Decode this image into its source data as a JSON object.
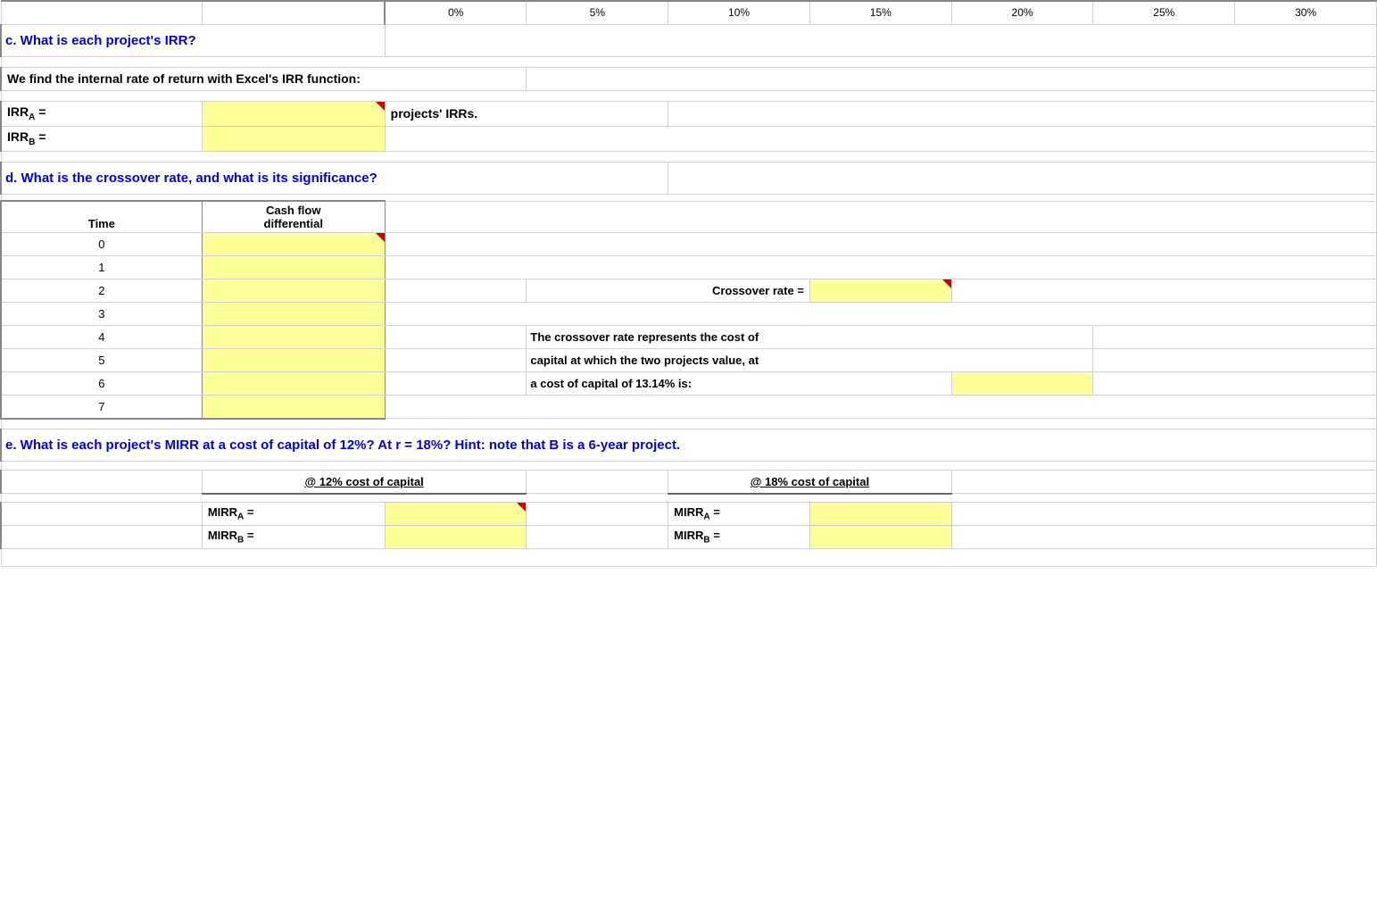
{
  "header": {
    "pct_labels": [
      "0%",
      "5%",
      "10%",
      "15%",
      "20%",
      "25%",
      "30%"
    ]
  },
  "section_c": {
    "title": "c.   What is each project's IRR?",
    "description": "We find the internal rate of return with Excel's  IRR function:",
    "irr_a_label": "IRR",
    "irr_a_sub": "A",
    "irr_a_equals": " =",
    "irr_b_label": "IRR",
    "irr_b_sub": "B",
    "irr_b_equals": " =",
    "projects_irrs": "projects' IRRs."
  },
  "section_d": {
    "title": "d.   What is the crossover rate, and what is its significance?",
    "table_header_time": "Time",
    "table_header_cf": "Cash flow",
    "table_header_diff": "differential",
    "time_values": [
      "0",
      "1",
      "2",
      "3",
      "4",
      "5",
      "6",
      "7"
    ],
    "crossover_label": "Crossover rate  =",
    "crossover_desc1": "The crossover rate represents the cost of",
    "crossover_desc2": "capital at which the two projects value, at",
    "crossover_desc3": "a cost of capital of 13.14% is:"
  },
  "section_e": {
    "title": "e.   What is each project's MIRR at a cost of capital of 12%?  At r = 18%? Hint: note that B is a 6-year project.",
    "label_12pct": "@ 12% cost of capital",
    "label_18pct": "@ 18% cost of capital",
    "mirr_a_label": "MIRR",
    "mirr_a_sub": "A",
    "mirr_a_equals": " =",
    "mirr_b_label": "MIRR",
    "mirr_b_sub": "B",
    "mirr_b_equals": " ="
  },
  "colors": {
    "yellow": "#ffff99",
    "blue": "#0000cc",
    "red_corner": "#cc0000"
  }
}
